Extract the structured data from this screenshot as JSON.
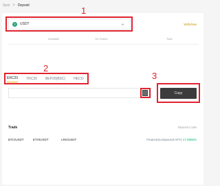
{
  "breadcrumb": {
    "spot": "Spot",
    "separator": ">",
    "current": "Deposit"
  },
  "annotations": {
    "marker_1": "1",
    "marker_2": "2",
    "marker_3": "3",
    "color": "#e0222e"
  },
  "coin": {
    "symbol": "USDT",
    "icon_glyph": "T",
    "icon_color": "#26a17b"
  },
  "withdraw_label": "Withdraw",
  "balance": {
    "headers": [
      "Available",
      "On Orders",
      "Total"
    ]
  },
  "networks": {
    "tabs": [
      "ERC20",
      "TRC20",
      "BEP20(BSC)",
      "HECO"
    ],
    "active": "ERC20"
  },
  "address": {
    "value": "",
    "copy_label": "Copy"
  },
  "trade": {
    "title": "Trade",
    "deposit_code_label": "Deposit Code",
    "pairs": [
      "BTC/USDT",
      "ETH/USDT",
      "LRK/USDT"
    ],
    "finance_label": "Finance(Compound APY)",
    "finance_apy": "17.0898%"
  },
  "colors": {
    "accent": "#f0b90b",
    "button": "#3c3c3c",
    "apy": "#02c076"
  }
}
